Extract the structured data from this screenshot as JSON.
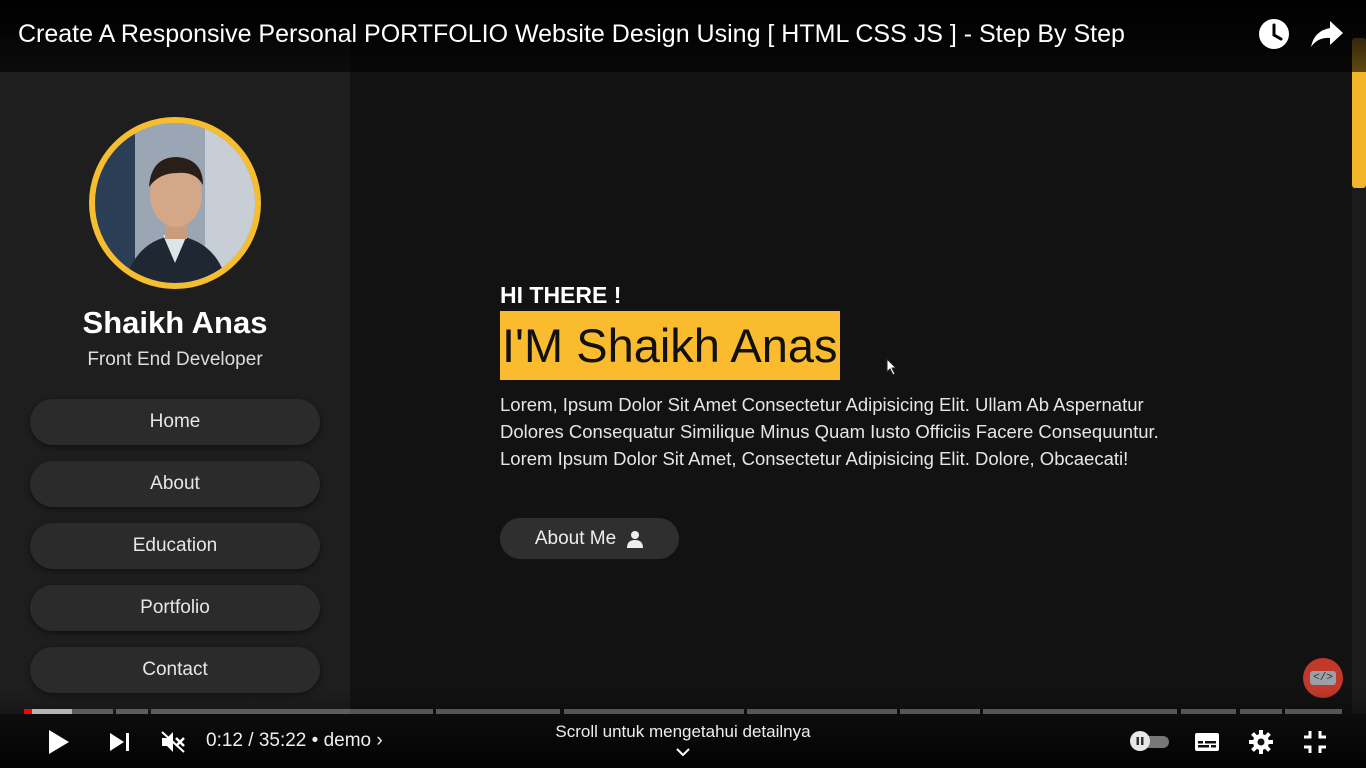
{
  "video": {
    "title": "Create A Responsive Personal PORTFOLIO Website Design Using [ HTML CSS JS ] - Step By Step"
  },
  "top_actions": [
    "watch-later-icon",
    "share-icon"
  ],
  "portfolio": {
    "profile": {
      "name": "Shaikh Anas",
      "role": "Front End Developer"
    },
    "nav": [
      "Home",
      "About",
      "Education",
      "Portfolio",
      "Contact"
    ],
    "hero": {
      "greeting": "HI THERE !",
      "headline": "I'M Shaikh Anas",
      "intro": "Lorem, Ipsum Dolor Sit Amet Consectetur Adipisicing Elit. Ullam Ab Aspernatur Dolores Consequatur Similique Minus Quam Iusto Officiis Facere Consequuntur. Lorem Ipsum Dolor Sit Amet, Consectetur Adipisicing Elit. Dolore, Obcaecati!",
      "button": "About Me"
    },
    "badge_text": "</>",
    "colors": {
      "accent": "#fbbb2e",
      "sidebar": "#1e1e1e",
      "main": "#121212"
    }
  },
  "player": {
    "time": "0:12 / 35:22",
    "separator": "•",
    "chapter": "demo",
    "scroll_hint": "Scroll untuk mengetahui detailnya",
    "progress_fraction": 0.0057,
    "controls": [
      "play-icon",
      "next-icon",
      "mute-icon",
      "autoplay-toggle",
      "subtitles-icon",
      "settings-icon",
      "exit-fullscreen-icon"
    ]
  }
}
